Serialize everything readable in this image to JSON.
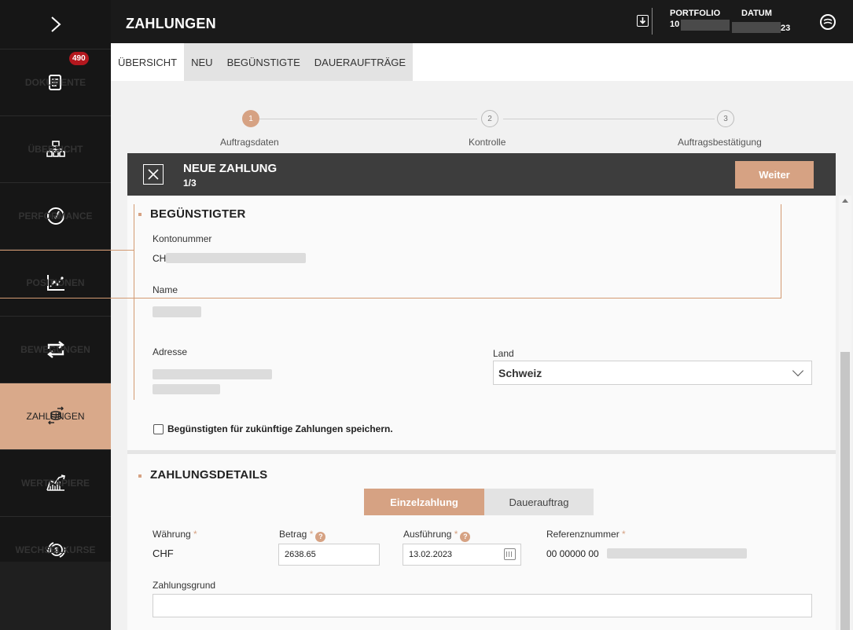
{
  "header": {
    "title": "ZAHLUNGEN",
    "portfolio_label": "PORTFOLIO",
    "portfolio_value": "10",
    "datum_label": "DATUM",
    "datum_value": "23"
  },
  "sidebar": {
    "toggle": "›",
    "badge": "490",
    "items": [
      {
        "label": "DOKUMENTE",
        "icon": "document-icon"
      },
      {
        "label": "ÜBERSICHT",
        "icon": "hierarchy-icon"
      },
      {
        "label": "PERFORMANCE",
        "icon": "gauge-icon"
      },
      {
        "label": "POSITIONEN",
        "icon": "chart-icon"
      },
      {
        "label": "BEWEGUNGEN",
        "icon": "arrows-icon"
      },
      {
        "label": "ZAHLUNGEN",
        "icon": "coins-icon"
      },
      {
        "label": "WERTPAPIERE",
        "icon": "securities-icon"
      },
      {
        "label": "WECHSELKURSE",
        "icon": "exchange-icon"
      }
    ]
  },
  "tabs": [
    "ÜBERSICHT",
    "NEU",
    "BEGÜNSTIGTE",
    "DAUERAUFTRÄGE"
  ],
  "stepper": [
    {
      "num": "1",
      "label": "Auftragsdaten"
    },
    {
      "num": "2",
      "label": "Kontrolle"
    },
    {
      "num": "3",
      "label": "Auftragsbestätigung"
    }
  ],
  "panel": {
    "title": "NEUE ZAHLUNG",
    "step": "1/3",
    "next_label": "Weiter"
  },
  "beneficiary": {
    "section_title": "BEGÜNSTIGTER",
    "account_label": "Kontonummer",
    "account_prefix": "CH",
    "name_label": "Name",
    "address_label": "Adresse",
    "country_label": "Land",
    "country_value": "Schweiz",
    "save_label": "Begünstigten für zukünftige Zahlungen speichern."
  },
  "details": {
    "section_title": "ZAHLUNGSDETAILS",
    "type_single": "Einzelzahlung",
    "type_standing": "Dauerauftrag",
    "currency_label": "Währung",
    "currency_value": "CHF",
    "amount_label": "Betrag",
    "amount_value": "2638.65",
    "execution_label": "Ausführung",
    "execution_value": "13.02.2023",
    "reference_label": "Referenznummer",
    "reference_prefix": "00 00000 00",
    "reason_label": "Zahlungsgrund",
    "required_mark": "*",
    "help_mark": "?"
  },
  "colors": {
    "accent": "#d6a283",
    "sidebar_bg": "#161616",
    "badge": "#b3171e"
  }
}
